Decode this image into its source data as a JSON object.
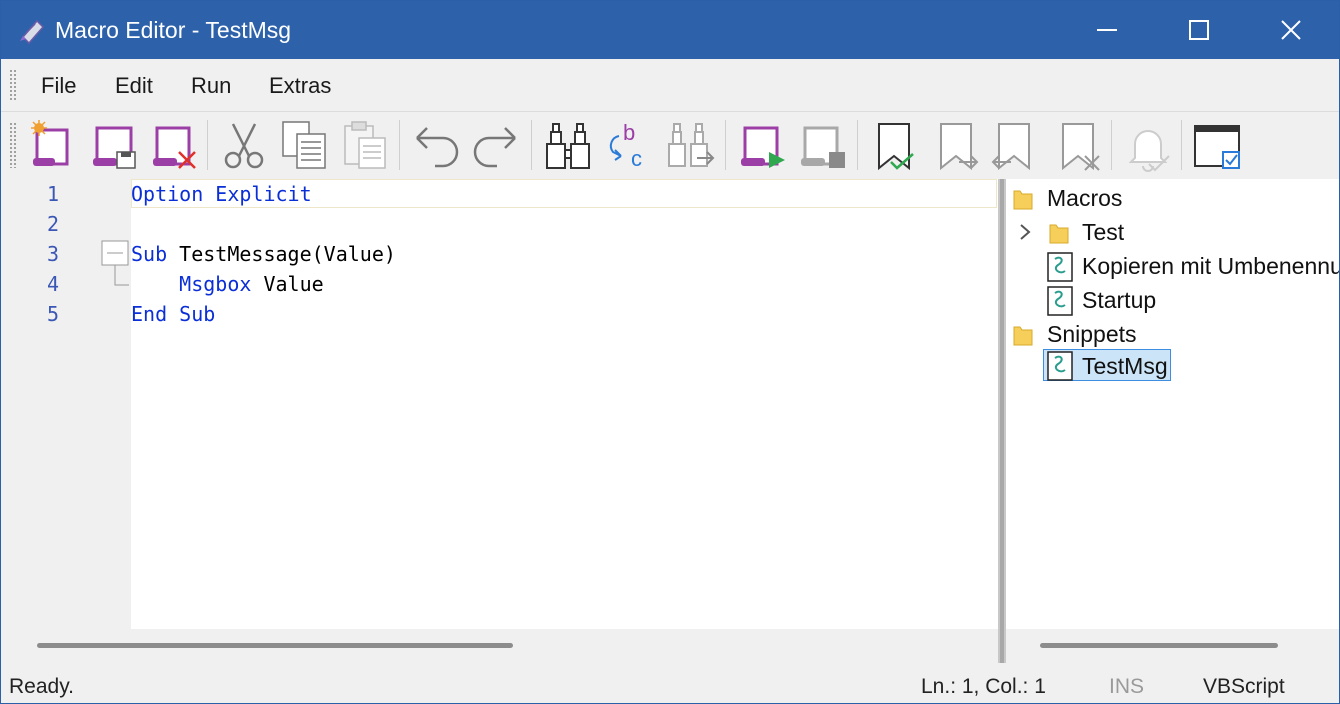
{
  "window": {
    "title": "Macro Editor - TestMsg"
  },
  "menu": {
    "items": [
      "File",
      "Edit",
      "Run",
      "Extras"
    ]
  },
  "toolbar": {
    "buttons": [
      {
        "name": "new-macro",
        "icon": "new-macro-icon"
      },
      {
        "name": "save-macro",
        "icon": "save-macro-icon"
      },
      {
        "name": "delete-macro",
        "icon": "delete-macro-icon"
      },
      {
        "name": "cut",
        "icon": "scissors-icon"
      },
      {
        "name": "copy",
        "icon": "copy-icon"
      },
      {
        "name": "paste",
        "icon": "paste-icon"
      },
      {
        "name": "undo",
        "icon": "undo-icon"
      },
      {
        "name": "redo",
        "icon": "redo-icon"
      },
      {
        "name": "find",
        "icon": "binoculars-icon"
      },
      {
        "name": "replace",
        "icon": "replace-icon"
      },
      {
        "name": "find-next",
        "icon": "find-next-icon"
      },
      {
        "name": "run-macro",
        "icon": "run-macro-icon"
      },
      {
        "name": "stop-macro",
        "icon": "stop-macro-icon"
      },
      {
        "name": "toggle-bookmark",
        "icon": "bookmark-check-icon"
      },
      {
        "name": "next-bookmark",
        "icon": "bookmark-next-icon"
      },
      {
        "name": "previous-bookmark",
        "icon": "bookmark-previous-icon"
      },
      {
        "name": "clear-bookmarks",
        "icon": "bookmark-clear-icon"
      },
      {
        "name": "notification",
        "icon": "bell-icon"
      },
      {
        "name": "toggle-panel",
        "icon": "panel-checkbox-icon"
      }
    ]
  },
  "editor": {
    "lines": [
      {
        "num": "1",
        "code": "Option Explicit"
      },
      {
        "num": "2",
        "code": ""
      },
      {
        "num": "3",
        "code": "Sub TestMessage(Value)"
      },
      {
        "num": "4",
        "code": "    Msgbox Value"
      },
      {
        "num": "5",
        "code": "End Sub"
      }
    ]
  },
  "tree": {
    "nodes": [
      {
        "label": "Macros",
        "type": "folder"
      },
      {
        "label": "Test",
        "type": "folder"
      },
      {
        "label": "Kopieren mit Umbenennung",
        "type": "script"
      },
      {
        "label": "Startup",
        "type": "script"
      },
      {
        "label": "Snippets",
        "type": "folder"
      },
      {
        "label": "TestMsg",
        "type": "script",
        "selected": true
      }
    ]
  },
  "status": {
    "message": "Ready.",
    "position": "Ln.: 1, Col.: 1",
    "mode": "INS",
    "language": "VBScript"
  },
  "colors": {
    "titlebar": "#2d62ab",
    "keyword": "#0b2fd6",
    "line_number": "#3b57b5",
    "accent_purple": "#9b3fa6"
  }
}
